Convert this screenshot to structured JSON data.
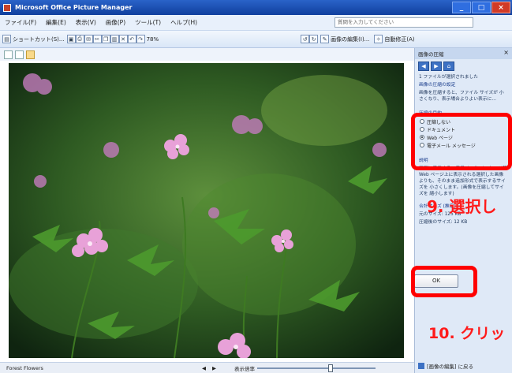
{
  "window": {
    "title": "Microsoft Office Picture Manager",
    "minimize": "_",
    "maximize": "□",
    "close": "×"
  },
  "menu": {
    "items": [
      "ファイル(F)",
      "編集(E)",
      "表示(V)",
      "画像(P)",
      "ツール(T)",
      "ヘルプ(H)"
    ],
    "help_placeholder": "質問を入力してください"
  },
  "toolbar": {
    "shortcut_label": "ショートカット(S)...",
    "zoom": "78%",
    "edit_label": "画像の編集(I)...",
    "autofix_label": "自動修正(A)"
  },
  "status": {
    "filename": "Forest Flowers",
    "nav_prev": "◀",
    "nav_next": "▶",
    "zoom_label": "表示倍率",
    "zoom_level": 0.62
  },
  "taskpane": {
    "title": "画像の圧縮",
    "close": "×",
    "selected_count": "1 ファイルが選択されました",
    "settings_heading": "画像の圧縮の設定",
    "settings_desc": "画像を圧縮すると、ファイル サイズが 小さくなり、表示場合よりよい表示に...",
    "purpose_heading": "圧縮の目的",
    "options": [
      "圧縮しない",
      "ドキュメント",
      "Web ページ",
      "電子メール メッセージ"
    ],
    "selected_option": 2,
    "desc_heading": "説明",
    "desc_text": "画面に表示する、電子メール メッセージ等 Web ページ上に表示される選択した画像 よりも、そのまま追加形式で表示するサイズを 小さくします。(画像を圧縮してサイズを 縮小します)",
    "size_heading": "合計サイズ (推定)",
    "original_size": "元のサイズ: 125 KB",
    "compressed_size": "圧縮後のサイズ: 12 KB",
    "ok_label": "OK",
    "back_link": "[画像の編集] に戻る"
  },
  "annotations": {
    "step9": "9. 選択し",
    "step10": "10. クリッ"
  },
  "colors": {
    "highlight": "#ff0000",
    "annotation": "#ff1a1a"
  }
}
